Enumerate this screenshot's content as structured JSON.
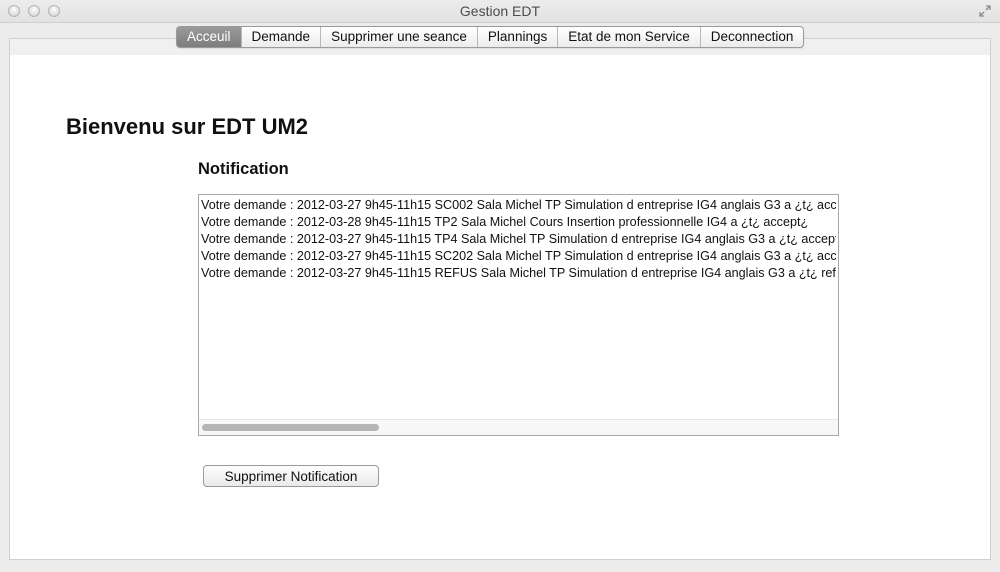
{
  "window": {
    "title": "Gestion EDT"
  },
  "tabs": [
    {
      "label": "Acceuil",
      "active": true
    },
    {
      "label": "Demande",
      "active": false
    },
    {
      "label": "Supprimer une seance",
      "active": false
    },
    {
      "label": "Plannings",
      "active": false
    },
    {
      "label": "Etat de mon Service",
      "active": false
    },
    {
      "label": "Deconnection",
      "active": false
    }
  ],
  "main": {
    "welcome": "Bienvenu sur EDT UM2",
    "notification_title": "Notification",
    "notifications": [
      "Votre demande : 2012-03-27 9h45-11h15  SC002 Sala Michel TP Simulation d entreprise IG4 anglais G3 a ¿t¿ accept¿",
      "Votre demande : 2012-03-28 9h45-11h15  TP2 Sala Michel Cours Insertion professionnelle IG4 a ¿t¿ accept¿",
      "Votre demande : 2012-03-27 9h45-11h15  TP4 Sala Michel TP Simulation d entreprise IG4 anglais G3 a ¿t¿ accept¿",
      "Votre demande : 2012-03-27 9h45-11h15  SC202 Sala Michel TP Simulation d entreprise IG4 anglais G3 a ¿t¿ accept¿",
      "Votre demande : 2012-03-27 9h45-11h15  REFUS Sala Michel TP Simulation d entreprise IG4 anglais G3 a ¿t¿ refus¿"
    ],
    "delete_button": "Supprimer Notification"
  }
}
